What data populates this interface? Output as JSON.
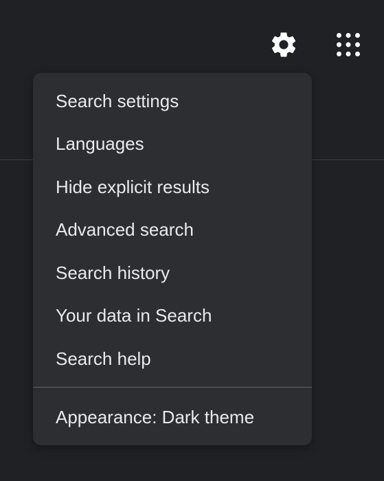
{
  "header": {
    "settings_icon": "gear-icon",
    "apps_icon": "apps-grid-icon"
  },
  "colors": {
    "background": "#202124",
    "menu_background": "#2d2e31",
    "text": "#e8eaed",
    "divider": "#5f6368"
  },
  "menu": {
    "items": [
      {
        "label": "Search settings"
      },
      {
        "label": "Languages"
      },
      {
        "label": "Hide explicit results"
      },
      {
        "label": "Advanced search"
      },
      {
        "label": "Search history"
      },
      {
        "label": "Your data in Search"
      },
      {
        "label": "Search help"
      }
    ],
    "footer_label": "Appearance: Dark theme"
  }
}
